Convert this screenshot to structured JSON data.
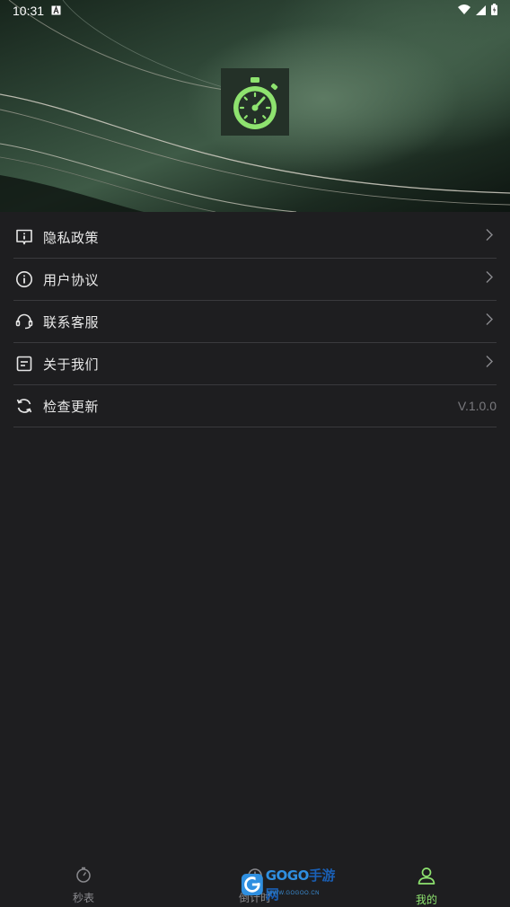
{
  "status_bar": {
    "time": "10:31"
  },
  "menu": {
    "items": [
      {
        "label": "隐私政策",
        "icon": "privacy-icon"
      },
      {
        "label": "用户协议",
        "icon": "info-icon"
      },
      {
        "label": "联系客服",
        "icon": "headset-icon"
      },
      {
        "label": "关于我们",
        "icon": "document-icon"
      },
      {
        "label": "检查更新",
        "icon": "refresh-icon",
        "value": "V.1.0.0"
      }
    ]
  },
  "tabbar": {
    "tabs": [
      {
        "label": "秒表",
        "icon": "stopwatch-icon",
        "active": false
      },
      {
        "label": "倒计时",
        "icon": "timer-icon",
        "active": false
      },
      {
        "label": "我的",
        "icon": "person-icon",
        "active": true
      }
    ]
  },
  "watermark": {
    "brand": "GOGO手游网",
    "sub": "WWW.GOGOO.CN"
  },
  "colors": {
    "accent": "#8ee36f",
    "background": "#1e1e20",
    "divider": "#3a3a3d",
    "inactive_tab": "#8a8a8e"
  }
}
